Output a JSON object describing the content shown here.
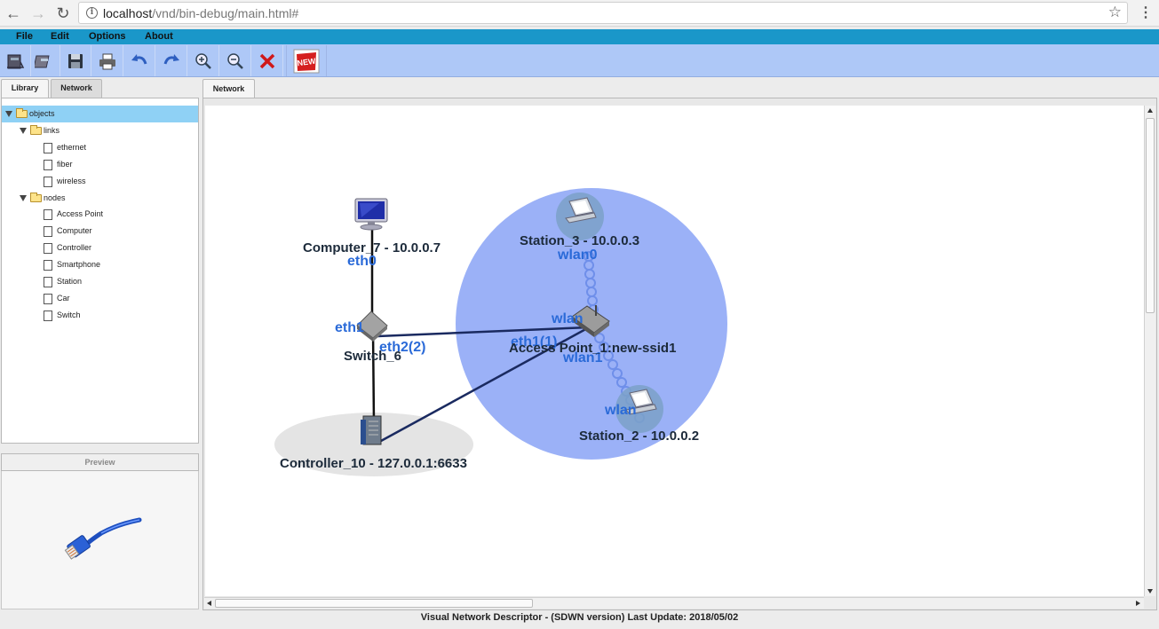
{
  "browser": {
    "url_host": "localhost",
    "url_path": "/vnd/bin-debug/main.html#"
  },
  "menu": {
    "items": [
      "File",
      "Edit",
      "Options",
      "About"
    ]
  },
  "toolbar": {
    "tools": [
      "open-file",
      "open-project",
      "save",
      "print",
      "undo",
      "redo",
      "zoom-in",
      "zoom-out",
      "delete",
      "new"
    ],
    "new_badge": "NEW"
  },
  "left_panel": {
    "tabs": [
      "Library",
      "Network"
    ],
    "active_tab": "Library",
    "tree": {
      "root": "objects",
      "links_folder": "links",
      "links": [
        "ethernet",
        "fiber",
        "wireless"
      ],
      "nodes_folder": "nodes",
      "nodes": [
        "Access Point",
        "Computer",
        "Controller",
        "Smartphone",
        "Station",
        "Car",
        "Switch"
      ]
    },
    "preview_title": "Preview"
  },
  "network": {
    "tab_label": "Network",
    "nodes": {
      "computer": "Computer_7 - 10.0.0.7",
      "switch": "Switch_6",
      "controller": "Controller_10 - 127.0.0.1:6633",
      "access_point": "Access Point_1:new-ssid1",
      "station3": "Station_3 - 10.0.0.3",
      "station2": "Station_2 - 10.0.0.2"
    },
    "interfaces": {
      "computer_eth0": "eth0",
      "switch_eth1": "eth1",
      "switch_eth2": "eth2(2)",
      "ap_eth1": "eth1(1)",
      "ap_wlan_top": "wlan",
      "ap_wlan1": "wlan1",
      "station3_wlan0": "wlan0",
      "station2_wlan": "wlan"
    },
    "colors": {
      "coverage": "#9bb1f7",
      "controller_area": "#e4e4e4",
      "interface_label": "#2a6ad8"
    }
  },
  "status_bar": {
    "text": "Visual Network Descriptor - (SDWN version)  Last Update: 2018/05/02"
  }
}
